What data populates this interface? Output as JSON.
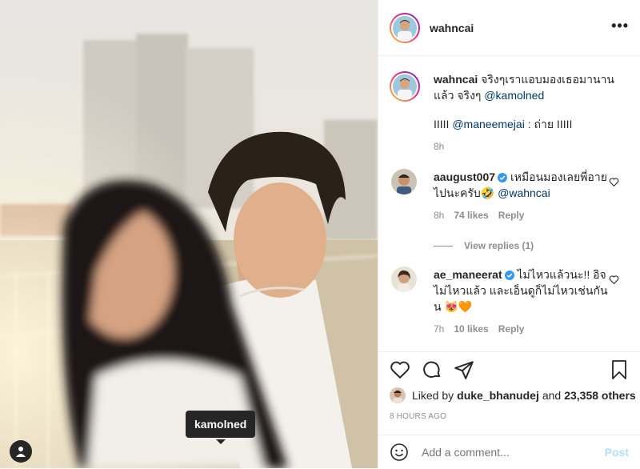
{
  "post": {
    "author": "wahncai",
    "caption": "จริงๆเราแอบมองเธอมานานแล้ว จริงๆ",
    "caption_mention": "@kamolned",
    "caption_line2_prefix": "IIIII",
    "caption_line2_mention": "@maneemejai",
    "caption_line2_suffix": ": ถ่าย IIIII",
    "caption_time": "8h",
    "photo_tag": "kamolned"
  },
  "comments": [
    {
      "user": "aaugust007",
      "verified": true,
      "text_line1": "เหมือนมองเลยพี่อาย",
      "text_line2": "ไปนะครับ🤣",
      "mention": "@wahncai",
      "time": "8h",
      "likes": "74 likes",
      "reply": "Reply",
      "view_replies": "View replies (1)"
    },
    {
      "user": "ae_maneerat",
      "verified": true,
      "text_line1": "ไม่ไหวแล้วนะ!! อิจ",
      "text_line2": "ไม่ไหวแล้ว และเอ็นดูก็ไม่ไหวเช่นกัน",
      "text_line3": "น 😻🧡",
      "time": "7h",
      "likes": "10 likes",
      "reply": "Reply"
    }
  ],
  "likes": {
    "prefix": "Liked by",
    "by": "duke_bhanudej",
    "and": "and",
    "count": "23,358 others"
  },
  "timestamp": "8 HOURS AGO",
  "add_comment": {
    "placeholder": "Add a comment...",
    "post_label": "Post"
  },
  "icons": [
    "more-icon",
    "heart-icon",
    "comment-icon",
    "share-icon",
    "bookmark-icon",
    "emoji-icon",
    "user-tag-icon",
    "verified-icon"
  ],
  "colors": {
    "link": "#00376b",
    "verified": "#3897f0",
    "muted": "#8e8e8e",
    "post_disabled": "#b2dffc"
  }
}
